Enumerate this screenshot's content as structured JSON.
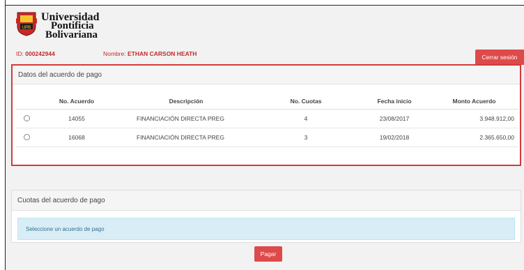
{
  "logo": {
    "line1": "Universidad",
    "line2": "Pontificia",
    "line3": "Bolivariana",
    "emblem_text": "UPB"
  },
  "user": {
    "id_label": "ID:",
    "id_value": "000242944",
    "name_label": "Nombre:",
    "name_value": "ETHAN CARSON HEATH"
  },
  "header": {
    "logout_label": "Cerrar sesión"
  },
  "agreements": {
    "title": "Datos del acuerdo de pago",
    "columns": [
      "No. Acuerdo",
      "Descripción",
      "No. Cuotas",
      "Fecha inicio",
      "Monto Acuerdo"
    ],
    "rows": [
      {
        "number": "14055",
        "description": "FINANCIACIÓN DIRECTA PREG",
        "installments": "4",
        "start_date": "23/08/2017",
        "amount": "3.948.912,00"
      },
      {
        "number": "16068",
        "description": "FINANCIACIÓN DIRECTA PREG",
        "installments": "3",
        "start_date": "19/02/2018",
        "amount": "2.365.650,00"
      }
    ]
  },
  "installments": {
    "title": "Cuotas del acuerdo de pago",
    "message": "Seleccione un acuerdo de pago"
  },
  "pay_label": "Pagar",
  "colors": {
    "accent_red": "#de4a4a",
    "highlight_border": "#d23b3b",
    "info_bg": "#d9edf7",
    "info_text": "#31708f"
  }
}
